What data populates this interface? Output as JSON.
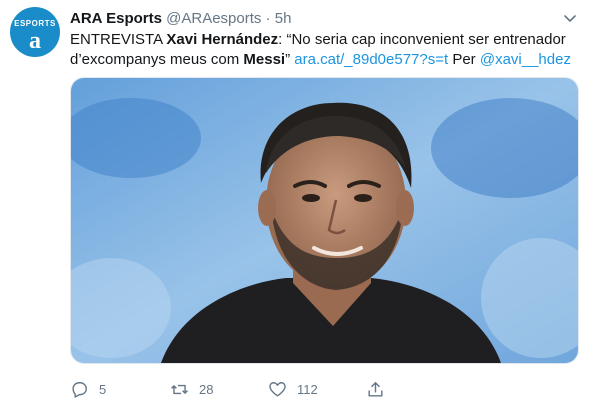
{
  "tweet": {
    "author": {
      "name": "ARA Esports",
      "handle": "@ARAesports",
      "separator": "·",
      "time": "5h",
      "avatar_text": "ESPORTS",
      "avatar_mark": "a",
      "avatar_color": "#1a8cc9"
    },
    "text": {
      "part1": "ENTREVISTA ",
      "bold1": "Xavi Hernández",
      "part2": ": “No seria cap inconvenient ser entrenador d’excompanys meus com ",
      "bold2": "Messi",
      "part3": "” ",
      "link1": "ara.cat/_89d0e577?s=t",
      "part4": " Per ",
      "link2": "@xavi__hdez"
    },
    "actions": {
      "replies": "5",
      "retweets": "28",
      "likes": "112"
    },
    "icons": {
      "more": "chevron-down-icon",
      "reply": "reply-icon",
      "retweet": "retweet-icon",
      "like": "heart-icon",
      "share": "share-icon"
    },
    "colors": {
      "link": "#1b95e0",
      "muted": "#657786"
    }
  }
}
